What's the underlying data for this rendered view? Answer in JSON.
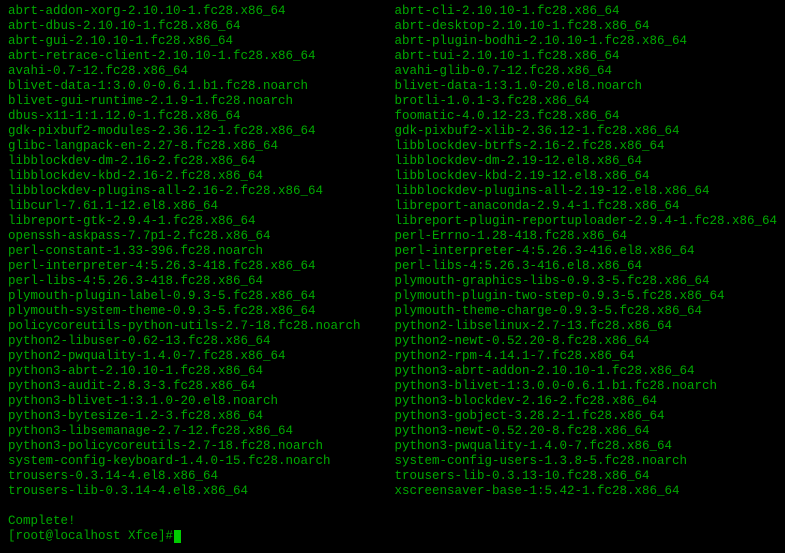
{
  "packages_left": [
    "abrt-addon-xorg-2.10.10-1.fc28.x86_64",
    "abrt-dbus-2.10.10-1.fc28.x86_64",
    "abrt-gui-2.10.10-1.fc28.x86_64",
    "abrt-retrace-client-2.10.10-1.fc28.x86_64",
    "avahi-0.7-12.fc28.x86_64",
    "blivet-data-1:3.0.0-0.6.1.b1.fc28.noarch",
    "blivet-gui-runtime-2.1.9-1.fc28.noarch",
    "dbus-x11-1:1.12.0-1.fc28.x86_64",
    "gdk-pixbuf2-modules-2.36.12-1.fc28.x86_64",
    "glibc-langpack-en-2.27-8.fc28.x86_64",
    "libblockdev-dm-2.16-2.fc28.x86_64",
    "libblockdev-kbd-2.16-2.fc28.x86_64",
    "libblockdev-plugins-all-2.16-2.fc28.x86_64",
    "libcurl-7.61.1-12.el8.x86_64",
    "libreport-gtk-2.9.4-1.fc28.x86_64",
    "openssh-askpass-7.7p1-2.fc28.x86_64",
    "perl-constant-1.33-396.fc28.noarch",
    "perl-interpreter-4:5.26.3-418.fc28.x86_64",
    "perl-libs-4:5.26.3-418.fc28.x86_64",
    "plymouth-plugin-label-0.9.3-5.fc28.x86_64",
    "plymouth-system-theme-0.9.3-5.fc28.x86_64",
    "policycoreutils-python-utils-2.7-18.fc28.noarch",
    "python2-libuser-0.62-13.fc28.x86_64",
    "python2-pwquality-1.4.0-7.fc28.x86_64",
    "python3-abrt-2.10.10-1.fc28.x86_64",
    "python3-audit-2.8.3-3.fc28.x86_64",
    "python3-blivet-1:3.1.0-20.el8.noarch",
    "python3-bytesize-1.2-3.fc28.x86_64",
    "python3-libsemanage-2.7-12.fc28.x86_64",
    "python3-policycoreutils-2.7-18.fc28.noarch",
    "system-config-keyboard-1.4.0-15.fc28.noarch",
    "trousers-0.3.14-4.el8.x86_64",
    "trousers-lib-0.3.14-4.el8.x86_64"
  ],
  "packages_right": [
    "abrt-cli-2.10.10-1.fc28.x86_64",
    "abrt-desktop-2.10.10-1.fc28.x86_64",
    "abrt-plugin-bodhi-2.10.10-1.fc28.x86_64",
    "abrt-tui-2.10.10-1.fc28.x86_64",
    "avahi-glib-0.7-12.fc28.x86_64",
    "blivet-data-1:3.1.0-20.el8.noarch",
    "brotli-1.0.1-3.fc28.x86_64",
    "foomatic-4.0.12-23.fc28.x86_64",
    "gdk-pixbuf2-xlib-2.36.12-1.fc28.x86_64",
    "libblockdev-btrfs-2.16-2.fc28.x86_64",
    "libblockdev-dm-2.19-12.el8.x86_64",
    "libblockdev-kbd-2.19-12.el8.x86_64",
    "libblockdev-plugins-all-2.19-12.el8.x86_64",
    "libreport-anaconda-2.9.4-1.fc28.x86_64",
    "libreport-plugin-reportuploader-2.9.4-1.fc28.x86_64",
    "perl-Errno-1.28-418.fc28.x86_64",
    "perl-interpreter-4:5.26.3-416.el8.x86_64",
    "perl-libs-4:5.26.3-416.el8.x86_64",
    "plymouth-graphics-libs-0.9.3-5.fc28.x86_64",
    "plymouth-plugin-two-step-0.9.3-5.fc28.x86_64",
    "plymouth-theme-charge-0.9.3-5.fc28.x86_64",
    "python2-libselinux-2.7-13.fc28.x86_64",
    "python2-newt-0.52.20-8.fc28.x86_64",
    "python2-rpm-4.14.1-7.fc28.x86_64",
    "python3-abrt-addon-2.10.10-1.fc28.x86_64",
    "python3-blivet-1:3.0.0-0.6.1.b1.fc28.noarch",
    "python3-blockdev-2.16-2.fc28.x86_64",
    "python3-gobject-3.28.2-1.fc28.x86_64",
    "python3-newt-0.52.20-8.fc28.x86_64",
    "python3-pwquality-1.4.0-7.fc28.x86_64",
    "system-config-users-1.3.8-5.fc28.noarch",
    "trousers-lib-0.3.13-10.fc28.x86_64",
    "xscreensaver-base-1:5.42-1.fc28.x86_64"
  ],
  "footer": {
    "complete": "Complete!",
    "prompt": "[root@localhost Xfce]# "
  }
}
